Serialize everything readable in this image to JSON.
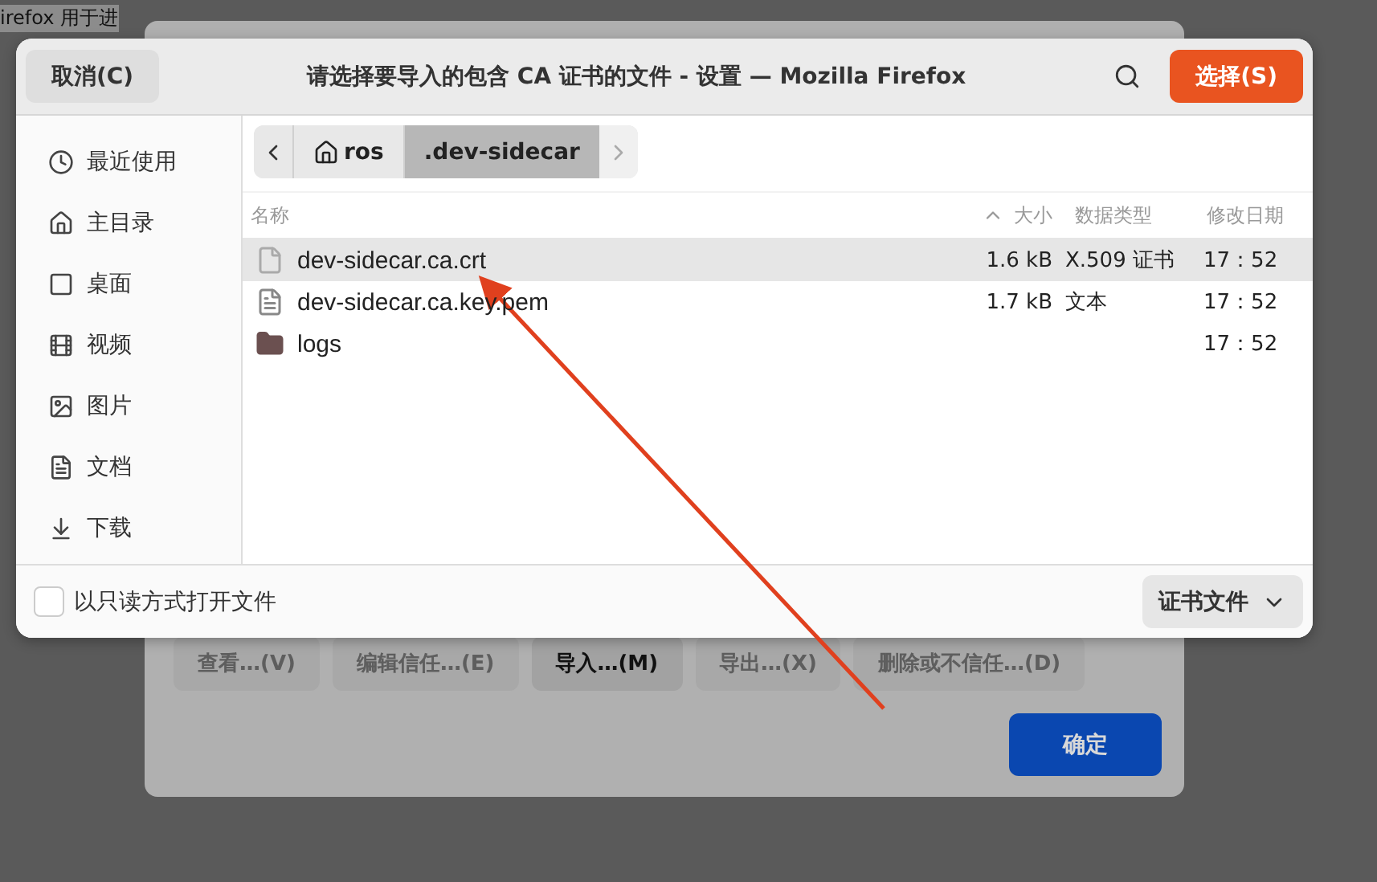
{
  "background_window": {
    "text_fragment": "irefox 用于进",
    "buttons": [
      {
        "label": "查看…(V)",
        "disabled": true
      },
      {
        "label": "编辑信任…(E)",
        "disabled": true
      },
      {
        "label": "导入…(M)",
        "disabled": false
      },
      {
        "label": "导出…(X)",
        "disabled": true
      },
      {
        "label": "删除或不信任…(D)",
        "disabled": true
      }
    ],
    "ok_button": "确定"
  },
  "dialog": {
    "title": "请选择要导入的包含 CA 证书的文件 - 设置 — Mozilla Firefox",
    "cancel_button": "取消(C)",
    "select_button": "选择(S)",
    "sidebar": {
      "items": [
        {
          "label": "最近使用"
        },
        {
          "label": "主目录"
        },
        {
          "label": "桌面"
        },
        {
          "label": "视频"
        },
        {
          "label": "图片"
        },
        {
          "label": "文档"
        },
        {
          "label": "下载"
        }
      ]
    },
    "path_bar": [
      {
        "label": "ros",
        "home": true,
        "selected": false
      },
      {
        "label": ".dev-sidecar",
        "home": false,
        "selected": true
      }
    ],
    "columns": [
      "名称",
      "大小",
      "数据类型",
      "修改日期"
    ],
    "rows": [
      {
        "name": "dev-sidecar.ca.crt",
        "kind": "file",
        "size": "1.6 kB",
        "type": "X.509 证书",
        "modified": "17：52",
        "selected": true
      },
      {
        "name": "dev-sidecar.ca.key.pem",
        "kind": "text",
        "size": "1.7 kB",
        "type": "文本",
        "modified": "17：52",
        "selected": false
      },
      {
        "name": "logs",
        "kind": "folder",
        "size": "",
        "type": "",
        "modified": "17：52",
        "selected": false
      }
    ],
    "read_only": {
      "label": "以只读方式打开文件",
      "checked": false
    },
    "filter": "证书文件"
  }
}
